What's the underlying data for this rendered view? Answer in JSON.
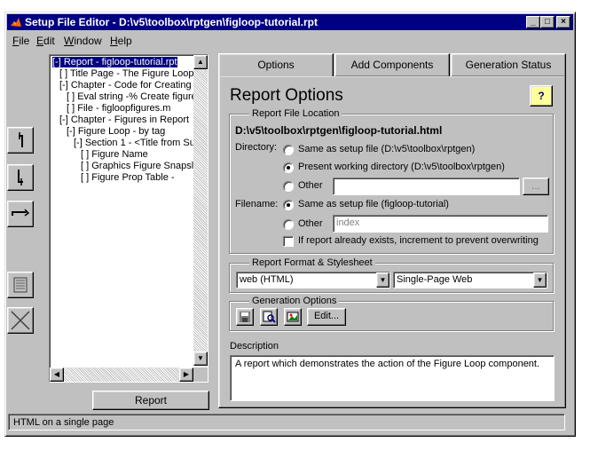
{
  "window": {
    "title": "Setup File Editor - D:\\v5\\toolbox\\rptgen\\figloop-tutorial.rpt",
    "minimize": "_",
    "maximize": "□",
    "close": "×"
  },
  "menu": [
    {
      "label": "File",
      "mnemonic": "F",
      "rest": "ile"
    },
    {
      "label": "Edit",
      "mnemonic": "E",
      "rest": "dit"
    },
    {
      "label": "Window",
      "mnemonic": "W",
      "rest": "indow"
    },
    {
      "label": "Help",
      "mnemonic": "H",
      "rest": "elp"
    }
  ],
  "tree": {
    "items": [
      "[-] Report - figloop-tutorial.rpt",
      "[ ] Title Page - The Figure Loop",
      "[-] Chapter - Code for Creating F",
      "[ ] Eval string -% Create figure",
      "[ ] File - figloopfigures.m",
      "[-] Chapter - Figures in Report",
      "[-] Figure Loop - by tag",
      "[-] Section 1 - <Title from Su",
      "[ ] Figure Name",
      "[ ] Graphics Figure Snapsl",
      "[ ] Figure Prop Table -"
    ]
  },
  "report_button": "Report",
  "tabs": [
    "Options",
    "Add Components",
    "Generation Status"
  ],
  "options": {
    "heading": "Report Options",
    "help": "?",
    "location": {
      "group": "Report File Location",
      "path": "D:\\v5\\toolbox\\rptgen\\figloop-tutorial.html",
      "directory_label": "Directory:",
      "dir_same": "Same as setup file (D:\\v5\\toolbox\\rptgen)",
      "dir_pwd": "Present working directory (D:\\v5\\toolbox\\rptgen)",
      "dir_other": "Other",
      "browse": "...",
      "filename_label": "Filename:",
      "file_same": "Same as setup file (figloop-tutorial)",
      "file_other": "Other",
      "file_other_value": "index",
      "increment": "If report already exists, increment to prevent overwriting"
    },
    "format": {
      "group": "Report Format & Stylesheet",
      "format_value": "web (HTML)",
      "stylesheet_value": "Single-Page Web"
    },
    "generation": {
      "group": "Generation Options",
      "edit": "Edit..."
    },
    "description_label": "Description",
    "description": "A report which demonstrates the action of the Figure Loop component."
  },
  "status": "HTML on a single page"
}
